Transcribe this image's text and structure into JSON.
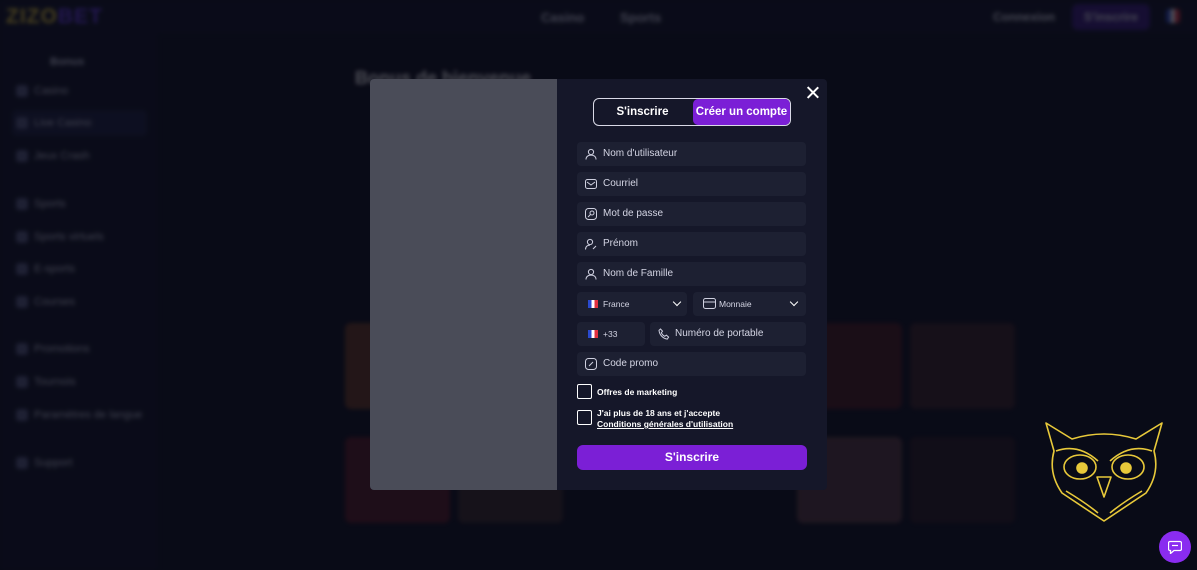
{
  "topbar": {
    "logo_a": "ZIZO",
    "logo_b": "BET",
    "nav": [
      "Casino",
      "Sports"
    ],
    "login_label": "Connexion",
    "signup_label": "S'inscrire"
  },
  "sidebar": {
    "title": "Bonus",
    "items": [
      "Casino",
      "Live Casino",
      "Jeux Crash",
      "Sports",
      "Sports virtuels",
      "E-sports",
      "Courses",
      "Promotions",
      "Tournois",
      "Paramètres de langue",
      "Support"
    ]
  },
  "hero": {
    "title": "Bonus de bienvenue"
  },
  "modal": {
    "tabs": {
      "signin": "S'inscrire",
      "create": "Créer un compte"
    },
    "fields": {
      "username": "Nom d'utilisateur",
      "email": "Courriel",
      "password": "Mot de passe",
      "first_name": "Prénom",
      "last_name": "Nom de Famille",
      "promo": "Code promo"
    },
    "country": "France",
    "currency": "Monnaie",
    "phone_code": "+33",
    "phone_placeholder": "Numéro de portable",
    "marketing": "Offres de marketing",
    "age_text": "J'ai plus de 18 ans et j'accepte",
    "terms_link": "Conditions générales d'utilisation",
    "submit": "S'inscrire"
  },
  "colors": {
    "accent": "#7b1fd6",
    "owl": "#e8c93a",
    "modal_bg": "#151729"
  }
}
